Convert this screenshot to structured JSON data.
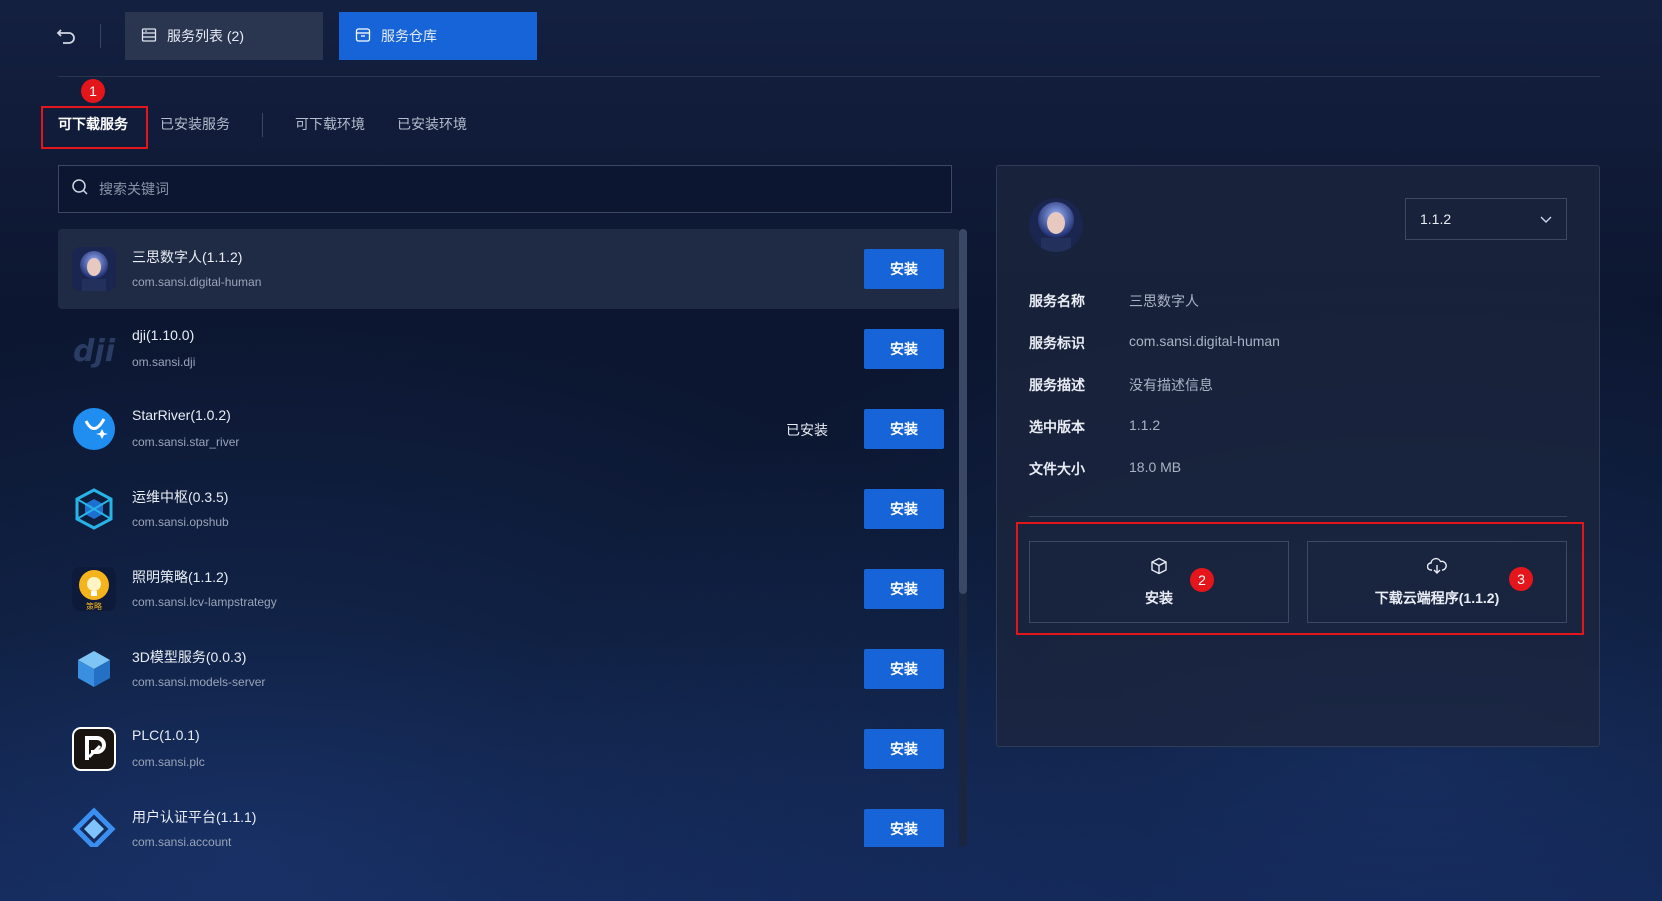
{
  "top_tabs": [
    {
      "label": "服务列表 (2)",
      "icon": "server-list-icon"
    },
    {
      "label": "服务仓库",
      "icon": "warehouse-icon",
      "active": true
    }
  ],
  "sub_tabs": [
    {
      "label": "可下载服务",
      "active": true
    },
    {
      "label": "已安装服务"
    },
    {
      "label": "可下载环境"
    },
    {
      "label": "已安装环境"
    }
  ],
  "markers": [
    "1",
    "2",
    "3"
  ],
  "search": {
    "placeholder": "搜索关键词",
    "value": ""
  },
  "services": [
    {
      "name": "三思数字人(1.1.2)",
      "id": "com.sansi.digital-human",
      "installed": "",
      "button": "安装",
      "icon": "digital-human-avatar"
    },
    {
      "name": "dji(1.10.0)",
      "id": "om.sansi.dji",
      "installed": "",
      "button": "安装",
      "icon": "dji-logo-icon"
    },
    {
      "name": "StarRiver(1.0.2)",
      "id": "com.sansi.star_river",
      "installed": "已安装",
      "button": "安装",
      "icon": "star-river-icon"
    },
    {
      "name": "运维中枢(0.3.5)",
      "id": "com.sansi.opshub",
      "installed": "",
      "button": "安装",
      "icon": "opshub-icon"
    },
    {
      "name": "照明策略(1.1.2)",
      "id": "com.sansi.lcv-lampstrategy",
      "installed": "",
      "button": "安装",
      "icon": "lamp-strategy-icon"
    },
    {
      "name": "3D模型服务(0.0.3)",
      "id": "com.sansi.models-server",
      "installed": "",
      "button": "安装",
      "icon": "cube-model-icon"
    },
    {
      "name": "PLC(1.0.1)",
      "id": "com.sansi.plc",
      "installed": "",
      "button": "安装",
      "icon": "plc-icon"
    },
    {
      "name": "用户认证平台(1.1.1)",
      "id": "com.sansi.account",
      "installed": "",
      "button": "安装",
      "icon": "account-auth-icon"
    }
  ],
  "lamp_icon_caption": "策略",
  "detail": {
    "version": "1.1.2",
    "fields": [
      {
        "label": "服务名称",
        "value": "三思数字人"
      },
      {
        "label": "服务标识",
        "value": "com.sansi.digital-human"
      },
      {
        "label": "服务描述",
        "value": "没有描述信息"
      },
      {
        "label": "选中版本",
        "value": "1.1.2"
      },
      {
        "label": "文件大小",
        "value": "18.0 MB"
      }
    ],
    "install_label": "安装",
    "download_label": "下载云端程序(1.1.2)"
  },
  "colors": {
    "accent": "#1764d8",
    "highlight_red": "#e5161b",
    "panel": "#1c263e",
    "background": "#0c1630"
  }
}
